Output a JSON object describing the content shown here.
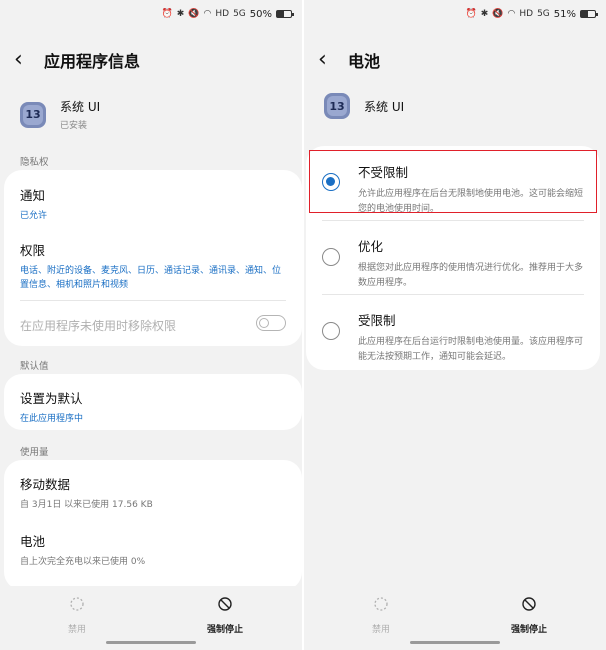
{
  "left": {
    "status": {
      "battery": "50%",
      "battery_level": 0.5
    },
    "header": {
      "title": "应用程序信息"
    },
    "app": {
      "icon_text": "13",
      "name": "系统 UI",
      "state": "已安装"
    },
    "privacy": {
      "label": "隐私权",
      "notification": {
        "title": "通知",
        "value": "已允许"
      },
      "permissions": {
        "title": "权限",
        "value": "电话、附近的设备、麦克风、日历、通话记录、通讯录、通知、位置信息、相机和照片和视频"
      },
      "remove_unused": {
        "title": "在应用程序未使用时移除权限",
        "enabled": false
      }
    },
    "defaults": {
      "label": "默认值",
      "set_default": {
        "title": "设置为默认",
        "value": "在此应用程序中"
      }
    },
    "usage": {
      "label": "使用量",
      "mobile_data": {
        "title": "移动数据",
        "value": "自 3月1日 以来已使用 17.56 KB"
      },
      "battery": {
        "title": "电池",
        "value": "自上次完全充电以来已使用 0%"
      }
    },
    "bottom": {
      "disable_label": "禁用",
      "force_stop_label": "强制停止"
    }
  },
  "right": {
    "status": {
      "battery": "51%",
      "battery_level": 0.51
    },
    "header": {
      "title": "电池"
    },
    "app": {
      "icon_text": "13",
      "name": "系统 UI"
    },
    "options": [
      {
        "title": "不受限制",
        "desc": "允许此应用程序在后台无限制地使用电池。这可能会缩短您的电池使用时间。",
        "selected": true
      },
      {
        "title": "优化",
        "desc": "根据您对此应用程序的使用情况进行优化。推荐用于大多数应用程序。",
        "selected": false
      },
      {
        "title": "受限制",
        "desc": "此应用程序在后台运行时限制电池使用量。该应用程序可能无法按预期工作，通知可能会延迟。",
        "selected": false
      }
    ],
    "bottom": {
      "disable_label": "禁用",
      "force_stop_label": "强制停止"
    }
  },
  "status_icons": {
    "hd": "HD",
    "signal": "5G"
  },
  "colors": {
    "accent": "#1a6fc4",
    "highlight_border": "#e0202a",
    "disabled": "#b0b0b0"
  }
}
